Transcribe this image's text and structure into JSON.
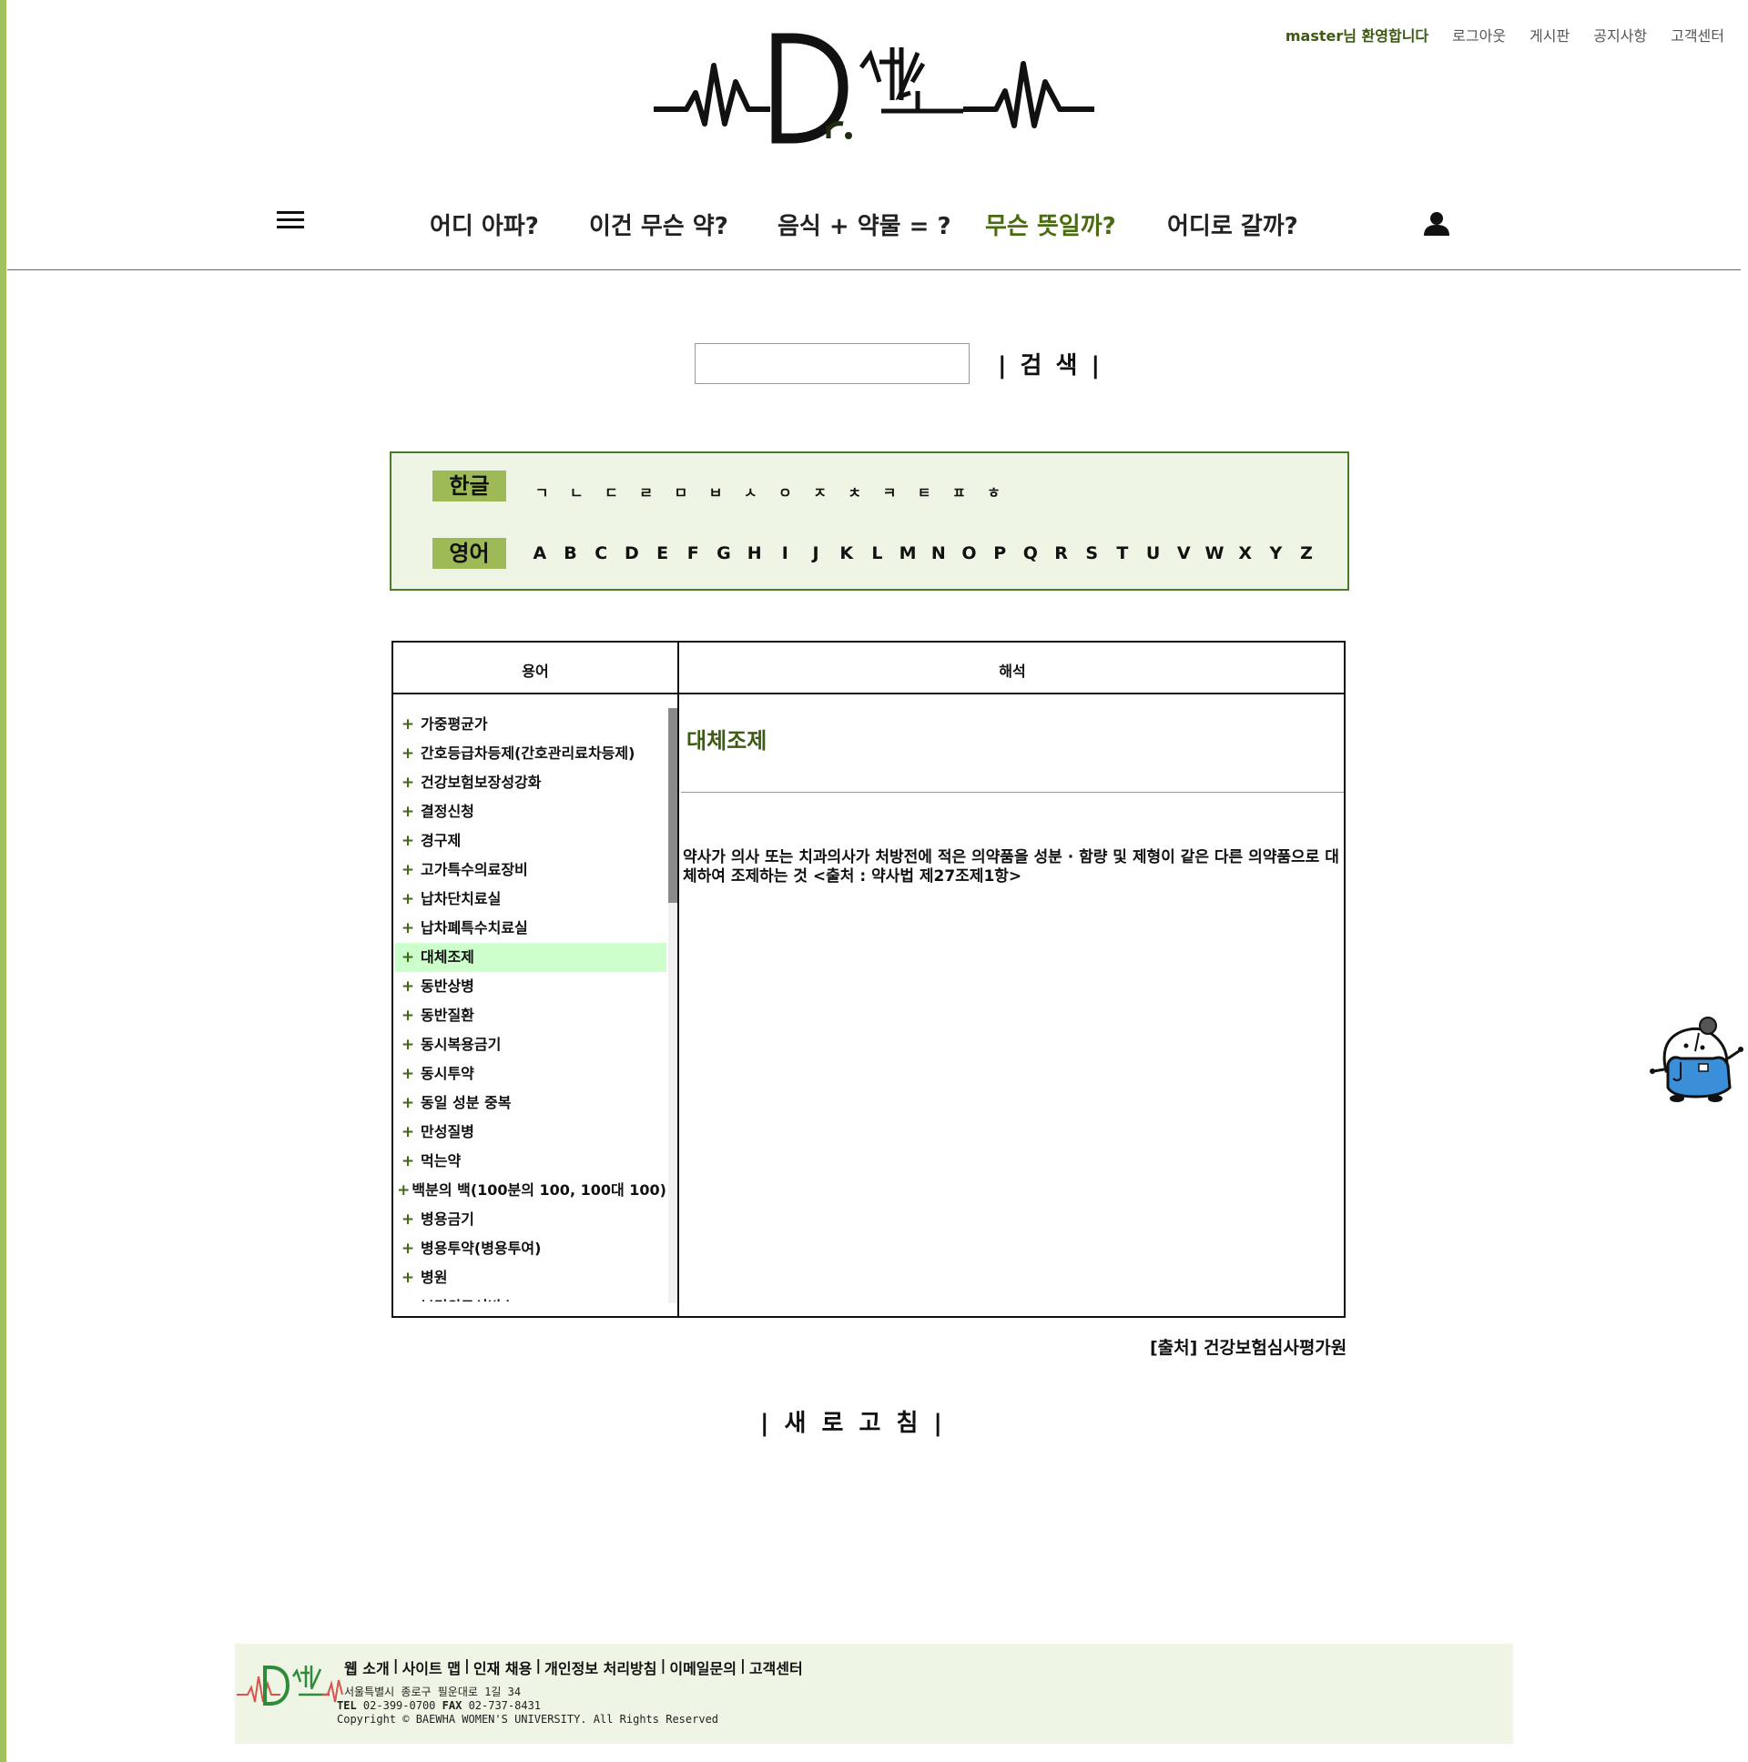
{
  "header": {
    "welcome": "master님 환영합니다",
    "links": [
      "로그아웃",
      "게시판",
      "공지사항",
      "고객센터"
    ]
  },
  "nav": {
    "items": [
      "어디 아파?",
      "이건 무슨 약?",
      "음식 + 약물 = ?",
      "무슨 뜻일까?",
      "어디로 갈까?"
    ],
    "active": "무슨 뜻일까?"
  },
  "search": {
    "value": "",
    "button": "| 검 색 |"
  },
  "alphabet": {
    "korean_label": "한글",
    "korean": [
      "ㄱ",
      "ㄴ",
      "ㄷ",
      "ㄹ",
      "ㅁ",
      "ㅂ",
      "ㅅ",
      "ㅇ",
      "ㅈ",
      "ㅊ",
      "ㅋ",
      "ㅌ",
      "ㅍ",
      "ㅎ"
    ],
    "english_label": "영어",
    "english": [
      "A",
      "B",
      "C",
      "D",
      "E",
      "F",
      "G",
      "H",
      "I",
      "J",
      "K",
      "L",
      "M",
      "N",
      "O",
      "P",
      "Q",
      "R",
      "S",
      "T",
      "U",
      "V",
      "W",
      "X",
      "Y",
      "Z"
    ]
  },
  "table": {
    "col_term": "용어",
    "col_desc": "해석",
    "terms": [
      "가중평균가",
      "간호등급차등제(간호관리료차등제)",
      "건강보험보장성강화",
      "결정신청",
      "경구제",
      "고가특수의료장비",
      "납차단치료실",
      "납차폐특수치료실",
      "대체조제",
      "동반상병",
      "동반질환",
      "동시복용금기",
      "동시투약",
      "동일 성분 중복",
      "만성질병",
      "먹는약",
      "백분의 백(100분의 100, 100대 100)",
      "병용금기",
      "병용투약(병용투여)",
      "병원",
      "보건의료서비스"
    ],
    "selected_index": 8,
    "detail_title": "대체조제",
    "detail_text": "약사가 의사 또는 치과의사가 처방전에 적은 의약품을 성분 · 함량 및 제형이 같은 다른 의약품으로 대체하여 조제하는 것 <출처 : 약사법 제27조제1항>"
  },
  "source": "[출처] 건강보험심사평가원",
  "refresh": "| 새 로 고 침 |",
  "footer": {
    "links": [
      "웹 소개",
      "사이트 맵",
      "인재 채용",
      "개인정보 처리방침",
      "이메일문의",
      "고객센터"
    ],
    "address": "서울특별시 종로구 필운대로 1길 34",
    "tel_label": "TEL",
    "tel": "02-399-0700",
    "fax_label": "FAX",
    "fax": "02-737-8431",
    "copyright": "Copyright © BAEWHA WOMEN'S UNIVERSITY. All Rights Reserved"
  },
  "colors": {
    "accent_green": "#a3c25d",
    "active_nav": "#4a6b10",
    "panel_bg": "#eef5e4",
    "selected_row": "#ccffcc"
  }
}
